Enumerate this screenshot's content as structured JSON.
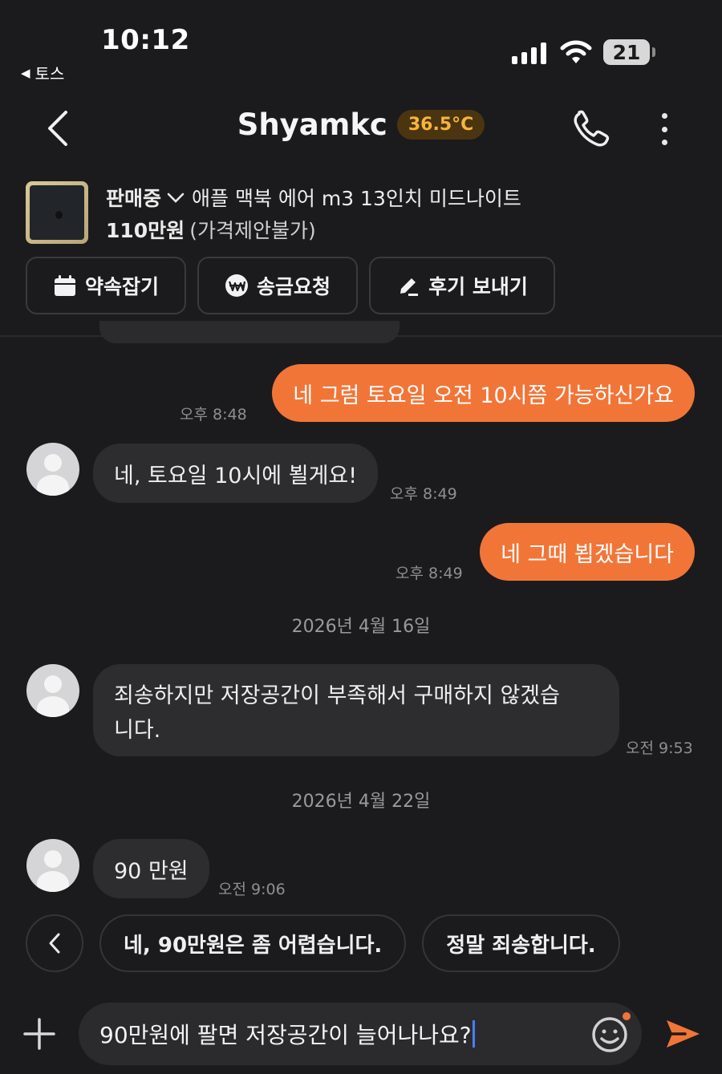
{
  "status_bar": {
    "time": "10:12",
    "back_app": "토스",
    "battery": "21"
  },
  "header": {
    "title": "Shyamkc",
    "temperature": "36.5°C",
    "accent_color": "#f27538",
    "temp_color": "#f8b43c"
  },
  "product": {
    "status": "판매중",
    "title": "애플 맥북 에어 m3 13인치 미드나이트",
    "price": "110만원",
    "price_note": "(가격제안불가)"
  },
  "actions": {
    "schedule": "약속잡기",
    "payment": "송금요청",
    "review": "후기 보내기"
  },
  "messages": [
    {
      "from": "me",
      "text": "네 그럼 토요일 오전 10시쯤 가능하신가요",
      "time": "오후 8:48"
    },
    {
      "from": "other",
      "text": "네, 토요일 10시에 뵐게요!",
      "time": "오후 8:49"
    },
    {
      "from": "me",
      "text": "네 그때 뵙겠습니다",
      "time": "오후 8:49"
    },
    {
      "from": "date",
      "text": "2026년 4월 16일"
    },
    {
      "from": "other",
      "text_line1": "죄송하지만 저장공간이 부족해서 구매하지 않겠습",
      "text_line2": "니다.",
      "time": "오전 9:53"
    },
    {
      "from": "date",
      "text": "2026년 4월 22일"
    },
    {
      "from": "other",
      "text": "90 만원",
      "time": "오전 9:06"
    }
  ],
  "quick_replies": [
    "네, 90만원은 좀 어렵습니다.",
    "정말 죄송합니다."
  ],
  "input": {
    "value": "90만원에 팔면 저장공간이 늘어나나요?"
  }
}
